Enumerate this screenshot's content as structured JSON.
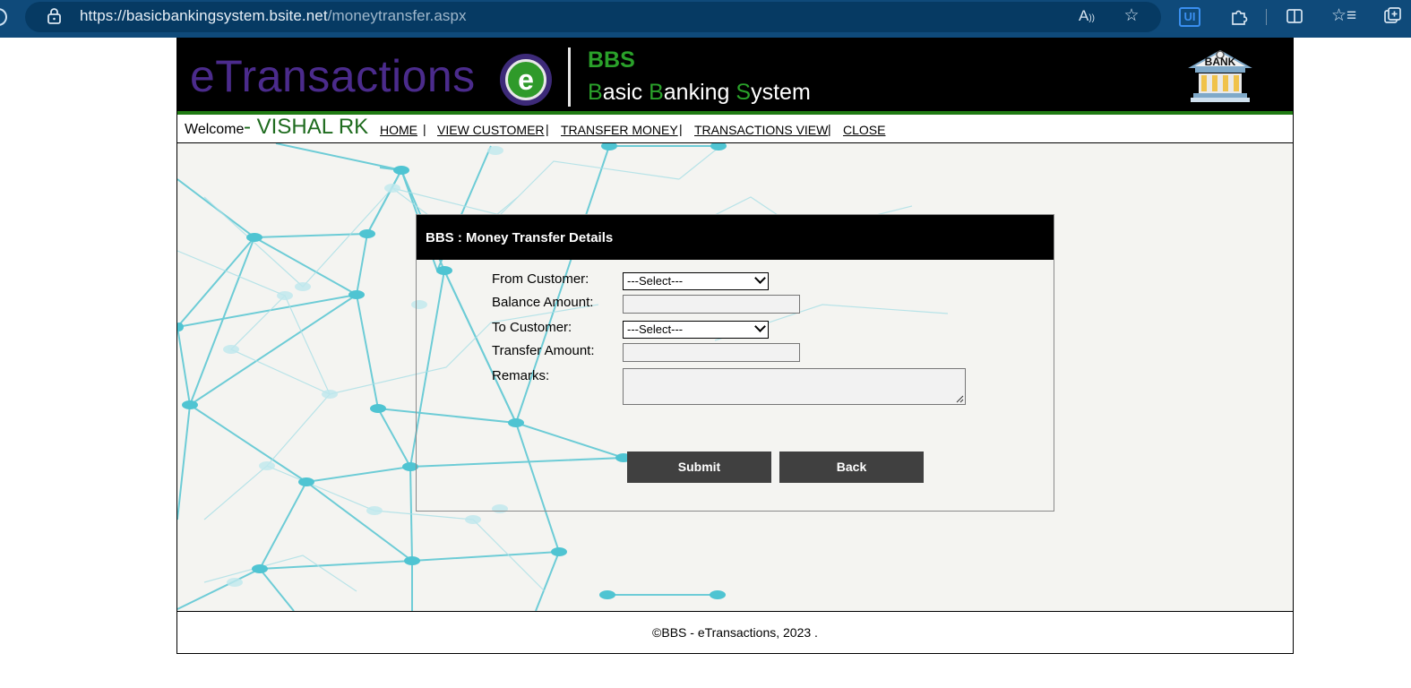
{
  "browser": {
    "url_host": "https://basicbankingsystem.bsite.net",
    "url_path": "/moneytransfer.aspx",
    "icons": [
      "lock-icon",
      "read-aloud-icon",
      "favorite-star-icon",
      "ui-extension-icon",
      "extensions-puzzle-icon",
      "split-screen-icon",
      "favorites-icon",
      "collections-icon"
    ],
    "ui_ext_label": "UI"
  },
  "header": {
    "brand": "eTransactions",
    "logo_letter": "e",
    "abbr": "BBS",
    "full_name_parts": [
      "B",
      "asic ",
      "B",
      "anking ",
      "S",
      "ystem"
    ],
    "bank_sign": "BANK"
  },
  "nav": {
    "welcome": "Welcome",
    "dash": " - ",
    "user": "VISHAL RK",
    "links": [
      "HOME",
      "VIEW CUSTOMER",
      "TRANSFER MONEY",
      "TRANSACTIONS VIEW",
      "CLOSE"
    ],
    "separator": "|"
  },
  "form": {
    "title": "BBS : Money Transfer Details",
    "from_customer_label": "From Customer:",
    "from_customer_value": "---Select---",
    "balance_label": "Balance Amount:",
    "balance_value": "",
    "to_customer_label": "To Customer:",
    "to_customer_value": "---Select---",
    "transfer_label": "Transfer Amount:",
    "transfer_value": "",
    "remarks_label": "Remarks:",
    "remarks_value": "",
    "submit": "Submit",
    "back": "Back"
  },
  "footer": {
    "text": "©BBS - eTransactions, 2023 ."
  },
  "colors": {
    "browser_bar": "#0f4a7a",
    "banner": "#000000",
    "brand_purple": "#4b2b8c",
    "brand_green": "#2aa12a",
    "user_green": "#1e6b1e",
    "button": "#404040",
    "network_lines": "#5fc8d4"
  }
}
